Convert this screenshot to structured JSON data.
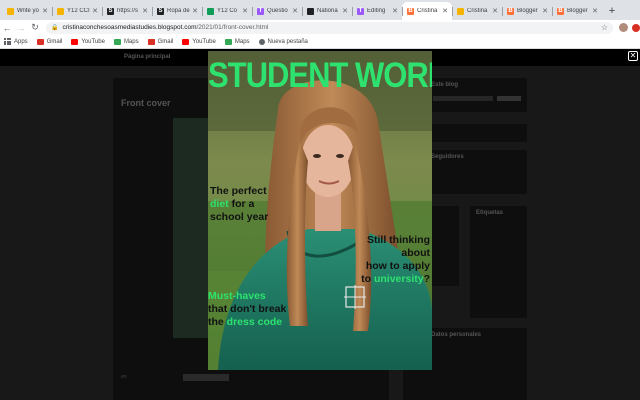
{
  "browser": {
    "tabs": [
      {
        "title": "Write yo",
        "favicon_color": "#f4b400",
        "favicon_char": "",
        "active": false
      },
      {
        "title": "Y12 CCI",
        "favicon_color": "#f4b400",
        "favicon_char": "",
        "active": false
      },
      {
        "title": "https://s",
        "favicon_color": "#202124",
        "favicon_char": "S",
        "active": false
      },
      {
        "title": "Ropa de",
        "favicon_color": "#202124",
        "favicon_char": "S",
        "active": false
      },
      {
        "title": "Y12 Co",
        "favicon_color": "#0f9d58",
        "favicon_char": "",
        "active": false
      },
      {
        "title": "Questio",
        "favicon_color": "#9b59ff",
        "favicon_char": "T",
        "active": false
      },
      {
        "title": "Nationa",
        "favicon_color": "#202124",
        "favicon_char": "",
        "active": false
      },
      {
        "title": "Editing",
        "favicon_color": "#9b59ff",
        "favicon_char": "T",
        "active": false
      },
      {
        "title": "Cristina",
        "favicon_color": "#ff7139",
        "favicon_char": "B",
        "active": true
      },
      {
        "title": "Cristina",
        "favicon_color": "#f4b400",
        "favicon_char": "",
        "active": false
      },
      {
        "title": "Blogger",
        "favicon_color": "#ff7139",
        "favicon_char": "B",
        "active": false
      },
      {
        "title": "Blogger",
        "favicon_color": "#ff7139",
        "favicon_char": "B",
        "active": false
      }
    ],
    "new_tab_label": "+",
    "url_host": "cristinaconchesoasmediastudies.blogspot.com",
    "url_path": "/2021/01/front-cover.html",
    "bookmarks": [
      {
        "label": "Apps",
        "icon": "apps-icon",
        "color": "#5f6368"
      },
      {
        "label": "Gmail",
        "icon": "gmail-icon",
        "color": "#d93025"
      },
      {
        "label": "YouTube",
        "icon": "youtube-icon",
        "color": "#ff0000"
      },
      {
        "label": "Maps",
        "icon": "maps-icon",
        "color": "#34a853"
      },
      {
        "label": "Gmail",
        "icon": "gmail-icon",
        "color": "#d93025"
      },
      {
        "label": "YouTube",
        "icon": "youtube-icon",
        "color": "#ff0000"
      },
      {
        "label": "Maps",
        "icon": "maps-icon",
        "color": "#34a853"
      },
      {
        "label": "Nueva pestaña",
        "icon": "globe-icon",
        "color": "#5f6368"
      }
    ]
  },
  "blog": {
    "nav_label": "Página principal",
    "post_title": "Front cover",
    "footer_label": "en",
    "sidebar_widgets": [
      "Este blog",
      "",
      "",
      "Seguidores",
      "",
      "Etiquetas",
      "Datos personales"
    ]
  },
  "cover": {
    "masthead": "STUDENT WORLD",
    "headline_diet": {
      "line1": "The perfect",
      "word_green": "diet",
      "line2_rest": " for a",
      "line3": "school year"
    },
    "headline_univ": {
      "line1": "Still thinking",
      "line2": "about",
      "line3": "how to apply",
      "line4_pre": "to ",
      "word_green": "university",
      "line4_post": "?"
    },
    "headline_must": {
      "line1_green": "Must-haves",
      "line2": "that don't break",
      "line3_pre": "the ",
      "word_green": "dress code"
    },
    "colors": {
      "accent": "#2ee26f",
      "text": "#111111",
      "hoodie": "#1f7a64"
    }
  },
  "lightbox": {
    "close_label": "✕"
  }
}
